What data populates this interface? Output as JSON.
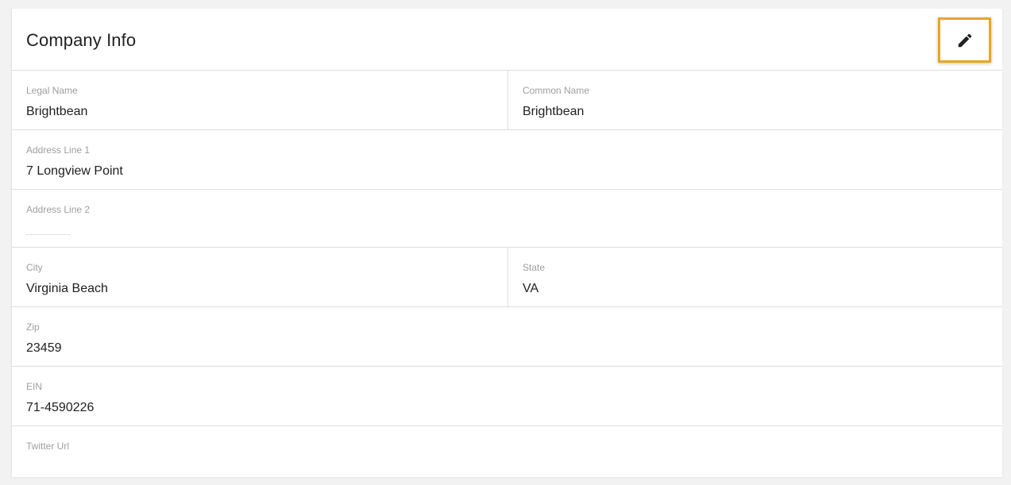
{
  "header": {
    "title": "Company Info",
    "edit_icon": "pencil-icon"
  },
  "fields": {
    "legal_name": {
      "label": "Legal Name",
      "value": "Brightbean"
    },
    "common_name": {
      "label": "Common Name",
      "value": "Brightbean"
    },
    "address_line_1": {
      "label": "Address Line 1",
      "value": "7 Longview Point"
    },
    "address_line_2": {
      "label": "Address Line 2",
      "value": ""
    },
    "city": {
      "label": "City",
      "value": "Virginia Beach"
    },
    "state": {
      "label": "State",
      "value": "VA"
    },
    "zip": {
      "label": "Zip",
      "value": "23459"
    },
    "ein": {
      "label": "EIN",
      "value": "71-4590226"
    },
    "twitter_url": {
      "label": "Twitter Url",
      "value": ""
    }
  },
  "colors": {
    "highlight": "#e8a623",
    "text": "#212121",
    "label": "#9e9e9e"
  }
}
